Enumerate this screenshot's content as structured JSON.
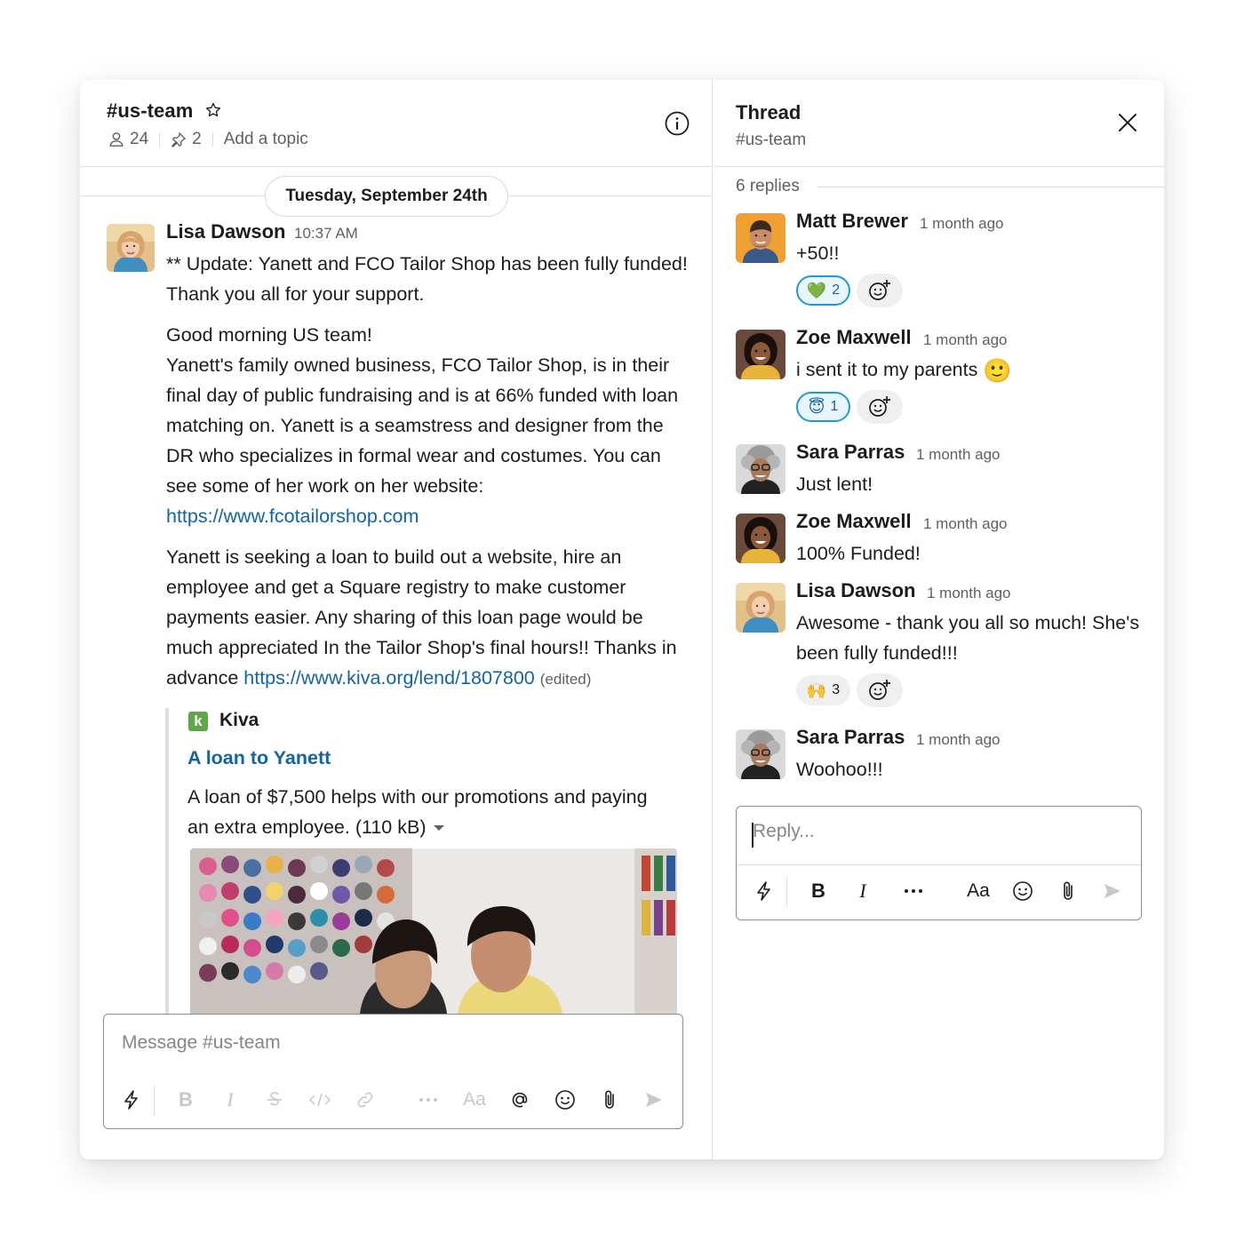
{
  "channel": {
    "name": "#us-team",
    "members": "24",
    "pins": "2",
    "topic_placeholder": "Add a topic"
  },
  "date_divider": "Tuesday, September 24th",
  "message": {
    "author": "Lisa Dawson",
    "time": "10:37 AM",
    "p1": "** Update: Yanett and FCO Tailor Shop has been fully funded! Thank you all for your support.",
    "p2_line1": "Good morning US team!",
    "p2_body": "Yanett's family owned business, FCO Tailor Shop, is in their final day of public fundraising and is at 66% funded with loan matching on. Yanett is a seamstress and designer from the DR who specializes in formal wear and costumes. You can see some of her work on her website:",
    "link1": "https://www.fcotailorshop.com",
    "p3_body": "Yanett is seeking a loan to build out a website, hire an employee and get a Square registry to make customer payments easier. Any sharing of this loan page would be much appreciated In the Tailor Shop's final hours!! Thanks in advance",
    "link2": "https://www.kiva.org/lend/1807800",
    "edited": "(edited)",
    "attachment": {
      "logo_letter": "k",
      "source": "Kiva",
      "title": "A loan to Yanett",
      "description": "A loan of $7,500 helps with our promotions and paying an extra employee. (110 kB)"
    }
  },
  "composer": {
    "placeholder": "Message #us-team",
    "format_label": "Aa"
  },
  "thread": {
    "title": "Thread",
    "channel": "#us-team",
    "replies_count": "6 replies",
    "replies": [
      {
        "author": "Matt Brewer",
        "time": "1 month ago",
        "text": "+50!!",
        "reaction_emoji": "💚",
        "reaction_count": "2"
      },
      {
        "author": "Zoe Maxwell",
        "time": "1 month ago",
        "text": "i sent it to my parents",
        "inline_emoji": "🙂",
        "reaction_emoji": "😇",
        "reaction_count": "1"
      },
      {
        "author": "Sara Parras",
        "time": "1 month ago",
        "text": "Just lent!"
      },
      {
        "author": "Zoe Maxwell",
        "time": "1 month ago",
        "text": "100% Funded!"
      },
      {
        "author": "Lisa Dawson",
        "time": "1 month ago",
        "text": "Awesome - thank you all so much! She's been fully funded!!!",
        "reaction_emoji": "🙌",
        "reaction_count": "3"
      },
      {
        "author": "Sara Parras",
        "time": "1 month ago",
        "text": "Woohoo!!!"
      }
    ],
    "reply_placeholder": "Reply...",
    "format_label": "Aa"
  },
  "colors": {
    "link": "#1264a3",
    "kiva_green": "#5fa84a",
    "reaction_active_border": "#1d9bd1"
  }
}
